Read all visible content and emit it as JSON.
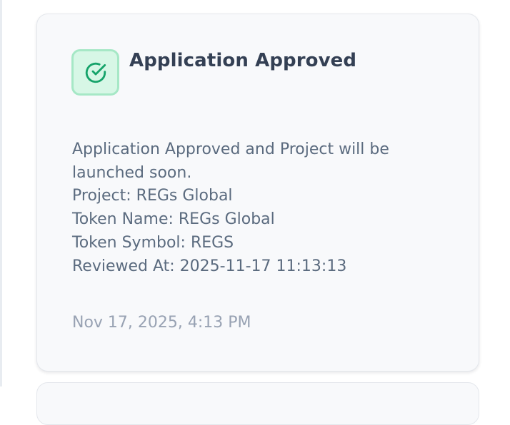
{
  "notification": {
    "title": "Application Approved",
    "icon": "check-circle-icon",
    "accent_color": "#16a36a",
    "message_lines": [
      "Application Approved and Project will be",
      "launched soon.",
      "Project: REGs Global",
      "Token Name: REGs Global",
      "Token Symbol: REGS",
      "Reviewed At: 2025-11-17 11:13:13"
    ],
    "timestamp": "Nov 17, 2025, 4:13 PM"
  }
}
